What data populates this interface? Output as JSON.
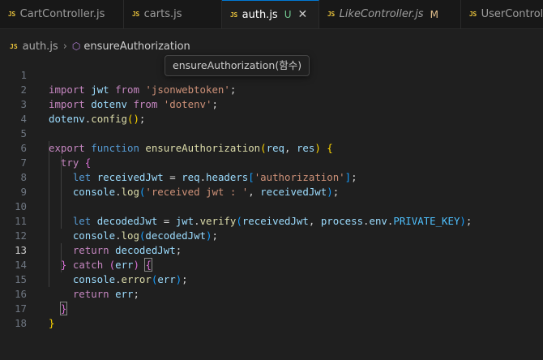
{
  "tabs": [
    {
      "label": "CartController.js",
      "icon": "js-file-icon",
      "active": false,
      "italic": false
    },
    {
      "label": "carts.js",
      "icon": "js-file-icon",
      "active": false,
      "italic": false
    },
    {
      "label": "auth.js",
      "icon": "js-file-icon",
      "active": true,
      "italic": false,
      "status": "U"
    },
    {
      "label": "LikeController.js",
      "icon": "js-file-icon",
      "active": false,
      "italic": true,
      "status": "M"
    },
    {
      "label": "UserControl",
      "icon": "js-file-icon",
      "active": false,
      "italic": false
    }
  ],
  "tab_icon_text": "JS",
  "tab_close_symbol": "✕",
  "breadcrumb": {
    "file": "auth.js",
    "symbol": "ensureAuthorization",
    "symbol_icon": "cube-icon"
  },
  "tooltip": "ensureAuthorization(함수)",
  "current_line": 13,
  "line_numbers": [
    "1",
    "2",
    "3",
    "4",
    "5",
    "6",
    "7",
    "8",
    "9",
    "10",
    "11",
    "12",
    "13",
    "14",
    "15",
    "16",
    "17",
    "18"
  ],
  "code_lines": [
    "import jwt from 'jsonwebtoken';",
    "import dotenv from 'dotenv';",
    "dotenv.config();",
    "",
    "export function ensureAuthorization(req, res) {",
    "  try {",
    "    let receivedJwt = req.headers['authorization'];",
    "    console.log('received jwt : ', receivedJwt);",
    "",
    "    let decodedJwt = jwt.verify(receivedJwt, process.env.PRIVATE_KEY);",
    "    console.log(decodedJwt);",
    "    return decodedJwt;",
    "  } catch (err) {",
    "    console.error(err);",
    "    return err;",
    "  }",
    "}",
    ""
  ],
  "colors": {
    "keyword": "#569cd6",
    "control": "#c586c0",
    "function": "#dcdcaa",
    "variable": "#9cdcfe",
    "string": "#ce9178",
    "constant": "#4fc1ff",
    "accent": "#0078d4"
  }
}
